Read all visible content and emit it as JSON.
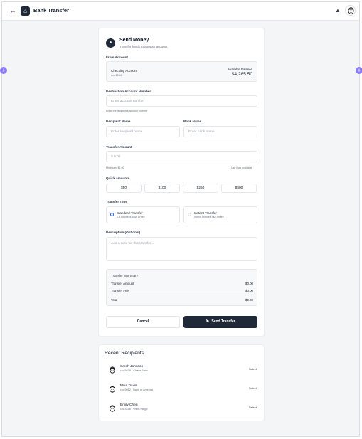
{
  "header": {
    "title": "Bank Transfer",
    "back_icon": "arrow-left-icon",
    "app_icon": "bank-icon",
    "bell_icon": "bell-icon"
  },
  "form": {
    "title": "Send Money",
    "subtitle": "Transfer funds to another account",
    "from_label": "From Account",
    "from_account": {
      "name": "Checking Account",
      "mask": "•••• 1234",
      "balance_label": "Available Balance",
      "balance": "$4,285.50"
    },
    "dest_label": "Destination Account Number",
    "dest_placeholder": "Enter account number",
    "dest_hint": "Enter the recipient's account number",
    "recipient_label": "Recipient Name",
    "recipient_placeholder": "Enter recipient name",
    "bank_label": "Bank Name",
    "bank_placeholder": "Enter bank name",
    "amount_label": "Transfer Amount",
    "amount_placeholder": "$ 0.00",
    "amount_min": "Minimum: $1.00",
    "amount_available": "Use max available",
    "quick_label": "Quick amounts",
    "quick_amounts": [
      "$50",
      "$100",
      "$250",
      "$500"
    ],
    "type_label": "Transfer Type",
    "types": [
      {
        "title": "Standard Transfer",
        "sub": "1-3 business days • Free",
        "selected": true
      },
      {
        "title": "Instant Transfer",
        "sub": "Within minutes • $2.99 fee",
        "selected": false
      }
    ],
    "desc_label": "Description (Optional)",
    "desc_placeholder": "Add a note for this transfer...",
    "summary": {
      "title": "Transfer Summary",
      "amount_label": "Transfer Amount",
      "amount_value": "$0.00",
      "fee_label": "Transfer Fee",
      "fee_value": "$0.00",
      "total_label": "Total",
      "total_value": "$0.00"
    },
    "cancel_label": "Cancel",
    "send_label": "Send Transfer"
  },
  "recent": {
    "title": "Recent Recipients",
    "select_label": "Select",
    "items": [
      {
        "name": "Sarah Johnson",
        "sub": "•••• 5678 • Chase Bank"
      },
      {
        "name": "Mike Davis",
        "sub": "•••• 9012 • Bank of America"
      },
      {
        "name": "Emily Chen",
        "sub": "•••• 3456 • Wells Fargo"
      }
    ]
  },
  "colors": {
    "accent": "#1f2937",
    "radio": "#2563eb",
    "plus": "#8b7cf6"
  }
}
